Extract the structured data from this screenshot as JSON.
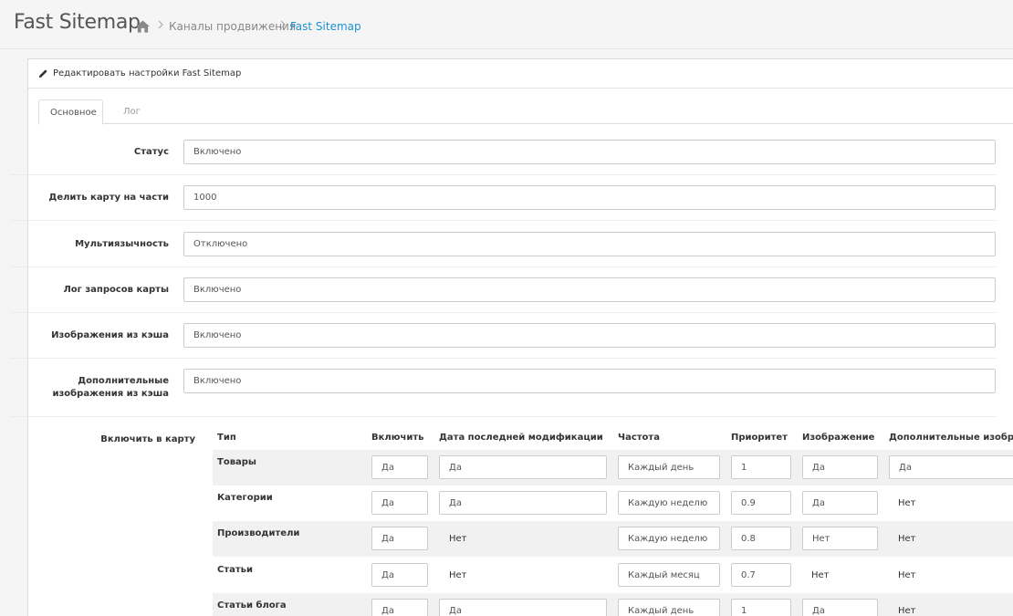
{
  "header": {
    "title": "Fast Sitemap",
    "breadcrumbs": [
      "Каналы продвижения",
      "Fast Sitemap"
    ]
  },
  "panel": {
    "title": "Редактировать настройки Fast Sitemap"
  },
  "tabs": [
    "Основное",
    "Лог"
  ],
  "settings": [
    {
      "label": "Статус",
      "value": "Включено"
    },
    {
      "label": "Делить карту на части",
      "value": "1000"
    },
    {
      "label": "Мультиязычность",
      "value": "Отключено"
    },
    {
      "label": "Лог запросов карты",
      "value": "Включено"
    },
    {
      "label": "Изображения из кэша",
      "value": "Включено"
    },
    {
      "label": "Дополнительные изображения из кэша",
      "value": "Включено"
    }
  ],
  "include_map": {
    "label": "Включить в карту",
    "columns": [
      "Тип",
      "Включить",
      "Дата последней модификации",
      "Частота",
      "Приоритет",
      "Изображение",
      "Дополнительные изображения"
    ],
    "rows": [
      {
        "type": "Товары",
        "enable": "Да",
        "lastmod": "Да",
        "freq": "Каждый день",
        "priority": "1",
        "image": "Да",
        "extra": "Да"
      },
      {
        "type": "Категории",
        "enable": "Да",
        "lastmod": "Да",
        "freq": "Каждую неделю",
        "priority": "0.9",
        "image": "Да",
        "extra": "Нет"
      },
      {
        "type": "Производители",
        "enable": "Да",
        "lastmod": "Нет",
        "freq": "Каждую неделю",
        "priority": "0.8",
        "image": "Нет",
        "extra": "Нет"
      },
      {
        "type": "Статьи",
        "enable": "Да",
        "lastmod": "Нет",
        "freq": "Каждый месяц",
        "priority": "0.7",
        "image": "Нет",
        "extra": "Нет"
      },
      {
        "type": "Статьи блога",
        "enable": "Да",
        "lastmod": "Да",
        "freq": "Каждый день",
        "priority": "1",
        "image": "Да",
        "extra": "Нет"
      }
    ]
  },
  "colors": {
    "accent": "#1e91cf",
    "text": "#333333",
    "muted": "#888888"
  },
  "icons": [
    "home-icon",
    "chevron-right-icon",
    "pencil-icon"
  ]
}
